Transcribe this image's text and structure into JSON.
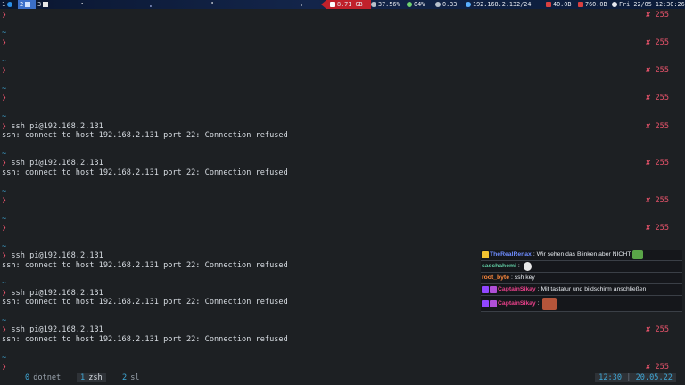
{
  "topbar": {
    "workspaces": [
      {
        "label": "1"
      },
      {
        "label": "2"
      },
      {
        "label": "3"
      }
    ],
    "memory": "8.71 GB",
    "cpu": "37.56%",
    "battery": "04%",
    "load": "0.33",
    "ip": "192.168.2.132/24",
    "disk1": "40.0B",
    "disk2": "760.0B",
    "clock": "Fri 22/05 12:30:26"
  },
  "terminal": {
    "tilde": "~",
    "prompt": "❯",
    "ssh_cmd": "ssh pi@192.168.2.131",
    "ssh_err": "ssh: connect to host 192.168.2.131 port 22: Connection refused",
    "exit_code": "✘ 255"
  },
  "chat": [
    {
      "user": "TheRealRenax",
      "text": "Wir sehen das Blinken aber NICHT",
      "color": "#6e8cff"
    },
    {
      "user": "saschahemi",
      "text": "",
      "color": "#5fc8a0"
    },
    {
      "user": "root_byte",
      "text": "ssh key",
      "color": "#ff8a3d"
    },
    {
      "user": "CaptainSikay",
      "text": "Mit tastatur und bildschirm anschließen",
      "color": "#e8408a"
    },
    {
      "user": "CaptainSikay",
      "text": "",
      "color": "#e8408a"
    }
  ],
  "tmux": {
    "windows": [
      {
        "num": "0",
        "name": "dotnet"
      },
      {
        "num": "1",
        "name": "zsh"
      },
      {
        "num": "2",
        "name": "sl"
      }
    ],
    "time": "12:30",
    "sep": "|",
    "date": "20.05.22"
  }
}
